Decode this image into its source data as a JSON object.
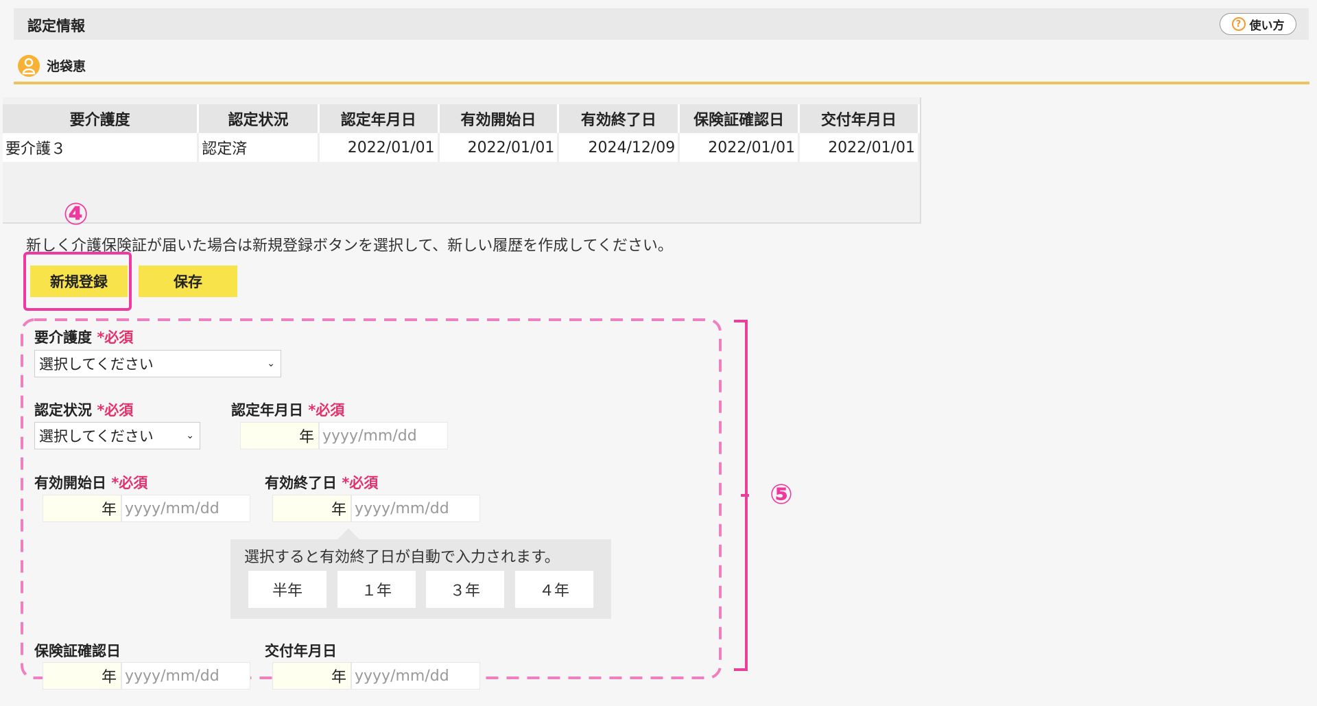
{
  "header": {
    "title": "認定情報",
    "help_label": "使い方",
    "help_icon_glyph": "?"
  },
  "user": {
    "name": "池袋恵"
  },
  "table": {
    "columns": [
      "要介護度",
      "認定状況",
      "認定年月日",
      "有効開始日",
      "有効終了日",
      "保険証確認日",
      "交付年月日"
    ],
    "rows": [
      [
        "要介護３",
        "認定済",
        "2022/01/01",
        "2022/01/01",
        "2024/12/09",
        "2022/01/01",
        "2022/01/01"
      ]
    ]
  },
  "annotations": {
    "marker_4": "④",
    "marker_5": "⑤"
  },
  "notice": "新しく介護保険証が届いた場合は新規登録ボタンを選択して、新しい履歴を作成してください。",
  "buttons": {
    "new_label": "新規登録",
    "save_label": "保存"
  },
  "form": {
    "required_mark": "*必須",
    "care_level": {
      "label": "要介護度",
      "value": "選択してください"
    },
    "status": {
      "label": "認定状況",
      "value": "選択してください"
    },
    "cert_date": {
      "label": "認定年月日",
      "year_suffix": "年",
      "placeholder": "yyyy/mm/dd"
    },
    "start_date": {
      "label": "有効開始日",
      "year_suffix": "年",
      "placeholder": "yyyy/mm/dd"
    },
    "end_date": {
      "label": "有効終了日",
      "year_suffix": "年",
      "placeholder": "yyyy/mm/dd"
    },
    "confirm_date": {
      "label": "保険証確認日",
      "year_suffix": "年",
      "placeholder": "yyyy/mm/dd"
    },
    "issue_date": {
      "label": "交付年月日",
      "year_suffix": "年",
      "placeholder": "yyyy/mm/dd"
    }
  },
  "tooltip": {
    "text": "選択すると有効終了日が自動で入力されます。",
    "options": [
      "半年",
      "１年",
      "３年",
      "４年"
    ]
  },
  "colors": {
    "accent_pink": "#ee3aa0",
    "button_yellow": "#f8e34a",
    "required_red": "#e5316b",
    "divider_gold": "#ecc35d"
  }
}
